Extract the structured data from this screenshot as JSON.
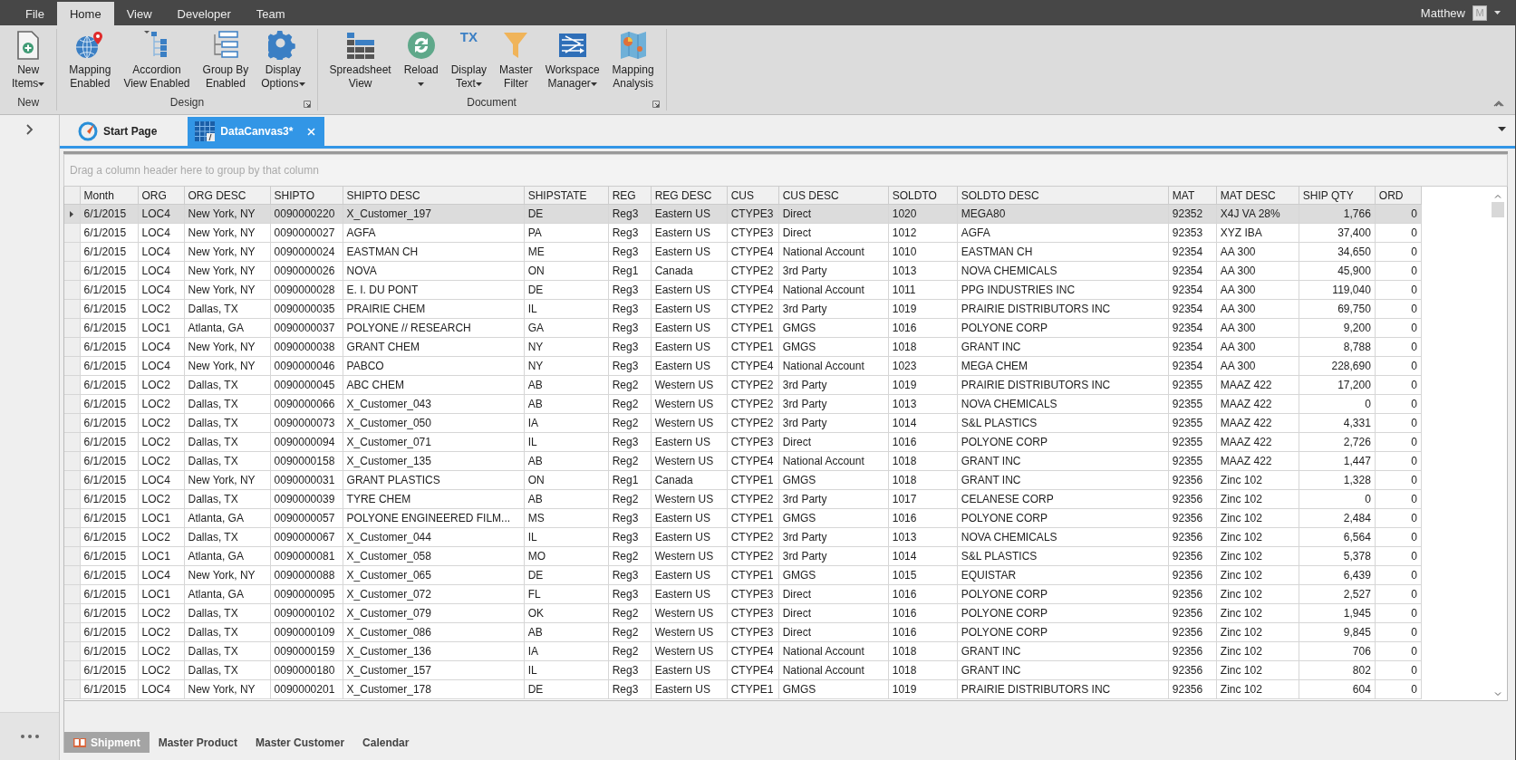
{
  "menu_tabs": [
    {
      "label": "File",
      "selected": false
    },
    {
      "label": "Home",
      "selected": true
    },
    {
      "label": "View",
      "selected": false
    },
    {
      "label": "Developer",
      "selected": false
    },
    {
      "label": "Team",
      "selected": false
    }
  ],
  "user": {
    "name": "Matthew",
    "avatar": "M"
  },
  "ribbon_groups": [
    {
      "label": "New",
      "launcher": false,
      "buttons": [
        {
          "lines": [
            "New",
            "Items"
          ],
          "dropdown": true
        }
      ]
    },
    {
      "label": "Design",
      "launcher": true,
      "buttons": [
        {
          "lines": [
            "Mapping",
            "Enabled"
          ],
          "dropdown": false
        },
        {
          "lines": [
            "Accordion",
            "View Enabled"
          ],
          "dropdown": false
        },
        {
          "lines": [
            "Group By",
            "Enabled"
          ],
          "dropdown": false
        },
        {
          "lines": [
            "Display",
            "Options"
          ],
          "dropdown": true
        }
      ]
    },
    {
      "label": "Document",
      "launcher": true,
      "buttons": [
        {
          "lines": [
            "Spreadsheet",
            "View"
          ],
          "dropdown": false
        },
        {
          "lines": [
            "Reload"
          ],
          "dropdown": true
        },
        {
          "lines": [
            "Display",
            "Text"
          ],
          "dropdown": true,
          "icon_text": "TX"
        },
        {
          "lines": [
            "Master",
            "Filter"
          ],
          "dropdown": false
        },
        {
          "lines": [
            "Workspace",
            "Manager"
          ],
          "dropdown": true
        },
        {
          "lines": [
            "Mapping",
            "Analysis"
          ],
          "dropdown": false
        }
      ]
    }
  ],
  "doc_tabs": [
    {
      "label": "Start Page",
      "selected": false,
      "closable": false
    },
    {
      "label": "DataCanvas3*",
      "selected": true,
      "closable": true
    }
  ],
  "group_panel": {
    "placeholder": "Drag a column header here to group by that column"
  },
  "table": {
    "columns": [
      "Month",
      "ORG",
      "ORG DESC",
      "SHIPTO",
      "SHIPTO DESC",
      "SHIPSTATE",
      "REG",
      "REG DESC",
      "CUS",
      "CUS DESC",
      "SOLDTO",
      "SOLDTO DESC",
      "MAT",
      "MAT DESC",
      "SHIP QTY",
      "ORD"
    ],
    "rows": [
      {
        "selected": true,
        "cells": [
          "6/1/2015",
          "LOC4",
          "New York, NY",
          "0090000220",
          "X_Customer_197",
          "DE",
          "Reg3",
          "Eastern US",
          "CTYPE3",
          "Direct",
          "1020",
          "MEGA80",
          "92352",
          "X4J VA 28%",
          "1,766",
          "0"
        ]
      },
      {
        "selected": false,
        "cells": [
          "6/1/2015",
          "LOC4",
          "New York, NY",
          "0090000027",
          "AGFA",
          "PA",
          "Reg3",
          "Eastern US",
          "CTYPE3",
          "Direct",
          "1012",
          "AGFA",
          "92353",
          "XYZ IBA",
          "37,400",
          "0"
        ]
      },
      {
        "selected": false,
        "cells": [
          "6/1/2015",
          "LOC4",
          "New York, NY",
          "0090000024",
          "EASTMAN CH",
          "ME",
          "Reg3",
          "Eastern US",
          "CTYPE4",
          "National Account",
          "1010",
          "EASTMAN CH",
          "92354",
          "AA 300",
          "34,650",
          "0"
        ]
      },
      {
        "selected": false,
        "cells": [
          "6/1/2015",
          "LOC4",
          "New York, NY",
          "0090000026",
          "NOVA",
          "ON",
          "Reg1",
          "Canada",
          "CTYPE2",
          "3rd Party",
          "1013",
          "NOVA CHEMICALS",
          "92354",
          "AA 300",
          "45,900",
          "0"
        ]
      },
      {
        "selected": false,
        "cells": [
          "6/1/2015",
          "LOC4",
          "New York, NY",
          "0090000028",
          "E. I. DU PONT",
          "DE",
          "Reg3",
          "Eastern US",
          "CTYPE4",
          "National Account",
          "1011",
          "PPG INDUSTRIES INC",
          "92354",
          "AA 300",
          "119,040",
          "0"
        ]
      },
      {
        "selected": false,
        "cells": [
          "6/1/2015",
          "LOC2",
          "Dallas, TX",
          "0090000035",
          "PRAIRIE CHEM",
          "IL",
          "Reg3",
          "Eastern US",
          "CTYPE2",
          "3rd Party",
          "1019",
          "PRAIRIE DISTRIBUTORS INC",
          "92354",
          "AA 300",
          "69,750",
          "0"
        ]
      },
      {
        "selected": false,
        "cells": [
          "6/1/2015",
          "LOC1",
          "Atlanta, GA",
          "0090000037",
          "POLYONE // RESEARCH",
          "GA",
          "Reg3",
          "Eastern US",
          "CTYPE1",
          "GMGS",
          "1016",
          "POLYONE CORP",
          "92354",
          "AA 300",
          "9,200",
          "0"
        ]
      },
      {
        "selected": false,
        "cells": [
          "6/1/2015",
          "LOC4",
          "New York, NY",
          "0090000038",
          "GRANT CHEM",
          "NY",
          "Reg3",
          "Eastern US",
          "CTYPE1",
          "GMGS",
          "1018",
          "GRANT INC",
          "92354",
          "AA 300",
          "8,788",
          "0"
        ]
      },
      {
        "selected": false,
        "cells": [
          "6/1/2015",
          "LOC4",
          "New York, NY",
          "0090000046",
          "PABCO",
          "NY",
          "Reg3",
          "Eastern US",
          "CTYPE4",
          "National Account",
          "1023",
          "MEGA CHEM",
          "92354",
          "AA 300",
          "228,690",
          "0"
        ]
      },
      {
        "selected": false,
        "cells": [
          "6/1/2015",
          "LOC2",
          "Dallas, TX",
          "0090000045",
          "ABC CHEM",
          "AB",
          "Reg2",
          "Western US",
          "CTYPE2",
          "3rd Party",
          "1019",
          "PRAIRIE DISTRIBUTORS INC",
          "92355",
          "MAAZ 422",
          "17,200",
          "0"
        ]
      },
      {
        "selected": false,
        "cells": [
          "6/1/2015",
          "LOC2",
          "Dallas, TX",
          "0090000066",
          "X_Customer_043",
          "AB",
          "Reg2",
          "Western US",
          "CTYPE2",
          "3rd Party",
          "1013",
          "NOVA CHEMICALS",
          "92355",
          "MAAZ 422",
          "0",
          "0"
        ]
      },
      {
        "selected": false,
        "cells": [
          "6/1/2015",
          "LOC2",
          "Dallas, TX",
          "0090000073",
          "X_Customer_050",
          "IA",
          "Reg2",
          "Western US",
          "CTYPE2",
          "3rd Party",
          "1014",
          "S&L PLASTICS",
          "92355",
          "MAAZ 422",
          "4,331",
          "0"
        ]
      },
      {
        "selected": false,
        "cells": [
          "6/1/2015",
          "LOC2",
          "Dallas, TX",
          "0090000094",
          "X_Customer_071",
          "IL",
          "Reg3",
          "Eastern US",
          "CTYPE3",
          "Direct",
          "1016",
          "POLYONE CORP",
          "92355",
          "MAAZ 422",
          "2,726",
          "0"
        ]
      },
      {
        "selected": false,
        "cells": [
          "6/1/2015",
          "LOC2",
          "Dallas, TX",
          "0090000158",
          "X_Customer_135",
          "AB",
          "Reg2",
          "Western US",
          "CTYPE4",
          "National Account",
          "1018",
          "GRANT INC",
          "92355",
          "MAAZ 422",
          "1,447",
          "0"
        ]
      },
      {
        "selected": false,
        "cells": [
          "6/1/2015",
          "LOC4",
          "New York, NY",
          "0090000031",
          "GRANT PLASTICS",
          "ON",
          "Reg1",
          "Canada",
          "CTYPE1",
          "GMGS",
          "1018",
          "GRANT INC",
          "92356",
          "Zinc 102",
          "1,328",
          "0"
        ]
      },
      {
        "selected": false,
        "cells": [
          "6/1/2015",
          "LOC2",
          "Dallas, TX",
          "0090000039",
          "TYRE CHEM",
          "AB",
          "Reg2",
          "Western US",
          "CTYPE2",
          "3rd Party",
          "1017",
          "CELANESE CORP",
          "92356",
          "Zinc 102",
          "0",
          "0"
        ]
      },
      {
        "selected": false,
        "cells": [
          "6/1/2015",
          "LOC1",
          "Atlanta, GA",
          "0090000057",
          "POLYONE ENGINEERED FILM...",
          "MS",
          "Reg3",
          "Eastern US",
          "CTYPE1",
          "GMGS",
          "1016",
          "POLYONE CORP",
          "92356",
          "Zinc 102",
          "2,484",
          "0"
        ]
      },
      {
        "selected": false,
        "cells": [
          "6/1/2015",
          "LOC2",
          "Dallas, TX",
          "0090000067",
          "X_Customer_044",
          "IL",
          "Reg3",
          "Eastern US",
          "CTYPE2",
          "3rd Party",
          "1013",
          "NOVA CHEMICALS",
          "92356",
          "Zinc 102",
          "6,564",
          "0"
        ]
      },
      {
        "selected": false,
        "cells": [
          "6/1/2015",
          "LOC1",
          "Atlanta, GA",
          "0090000081",
          "X_Customer_058",
          "MO",
          "Reg2",
          "Western US",
          "CTYPE2",
          "3rd Party",
          "1014",
          "S&L PLASTICS",
          "92356",
          "Zinc 102",
          "5,378",
          "0"
        ]
      },
      {
        "selected": false,
        "cells": [
          "6/1/2015",
          "LOC4",
          "New York, NY",
          "0090000088",
          "X_Customer_065",
          "DE",
          "Reg3",
          "Eastern US",
          "CTYPE1",
          "GMGS",
          "1015",
          "EQUISTAR",
          "92356",
          "Zinc 102",
          "6,439",
          "0"
        ]
      },
      {
        "selected": false,
        "cells": [
          "6/1/2015",
          "LOC1",
          "Atlanta, GA",
          "0090000095",
          "X_Customer_072",
          "FL",
          "Reg3",
          "Eastern US",
          "CTYPE3",
          "Direct",
          "1016",
          "POLYONE CORP",
          "92356",
          "Zinc 102",
          "2,527",
          "0"
        ]
      },
      {
        "selected": false,
        "cells": [
          "6/1/2015",
          "LOC2",
          "Dallas, TX",
          "0090000102",
          "X_Customer_079",
          "OK",
          "Reg2",
          "Western US",
          "CTYPE3",
          "Direct",
          "1016",
          "POLYONE CORP",
          "92356",
          "Zinc 102",
          "1,945",
          "0"
        ]
      },
      {
        "selected": false,
        "cells": [
          "6/1/2015",
          "LOC2",
          "Dallas, TX",
          "0090000109",
          "X_Customer_086",
          "AB",
          "Reg2",
          "Western US",
          "CTYPE3",
          "Direct",
          "1016",
          "POLYONE CORP",
          "92356",
          "Zinc 102",
          "9,845",
          "0"
        ]
      },
      {
        "selected": false,
        "cells": [
          "6/1/2015",
          "LOC2",
          "Dallas, TX",
          "0090000159",
          "X_Customer_136",
          "IA",
          "Reg2",
          "Western US",
          "CTYPE4",
          "National Account",
          "1018",
          "GRANT INC",
          "92356",
          "Zinc 102",
          "706",
          "0"
        ]
      },
      {
        "selected": false,
        "cells": [
          "6/1/2015",
          "LOC2",
          "Dallas, TX",
          "0090000180",
          "X_Customer_157",
          "IL",
          "Reg3",
          "Eastern US",
          "CTYPE4",
          "National Account",
          "1018",
          "GRANT INC",
          "92356",
          "Zinc 102",
          "802",
          "0"
        ]
      },
      {
        "selected": false,
        "cells": [
          "6/1/2015",
          "LOC4",
          "New York, NY",
          "0090000201",
          "X_Customer_178",
          "DE",
          "Reg3",
          "Eastern US",
          "CTYPE1",
          "GMGS",
          "1019",
          "PRAIRIE DISTRIBUTORS INC",
          "92356",
          "Zinc 102",
          "604",
          "0"
        ]
      }
    ]
  },
  "sheet_tabs": [
    {
      "label": "Shipment",
      "selected": true
    },
    {
      "label": "Master Product",
      "selected": false
    },
    {
      "label": "Master Customer",
      "selected": false
    },
    {
      "label": "Calendar",
      "selected": false
    }
  ]
}
